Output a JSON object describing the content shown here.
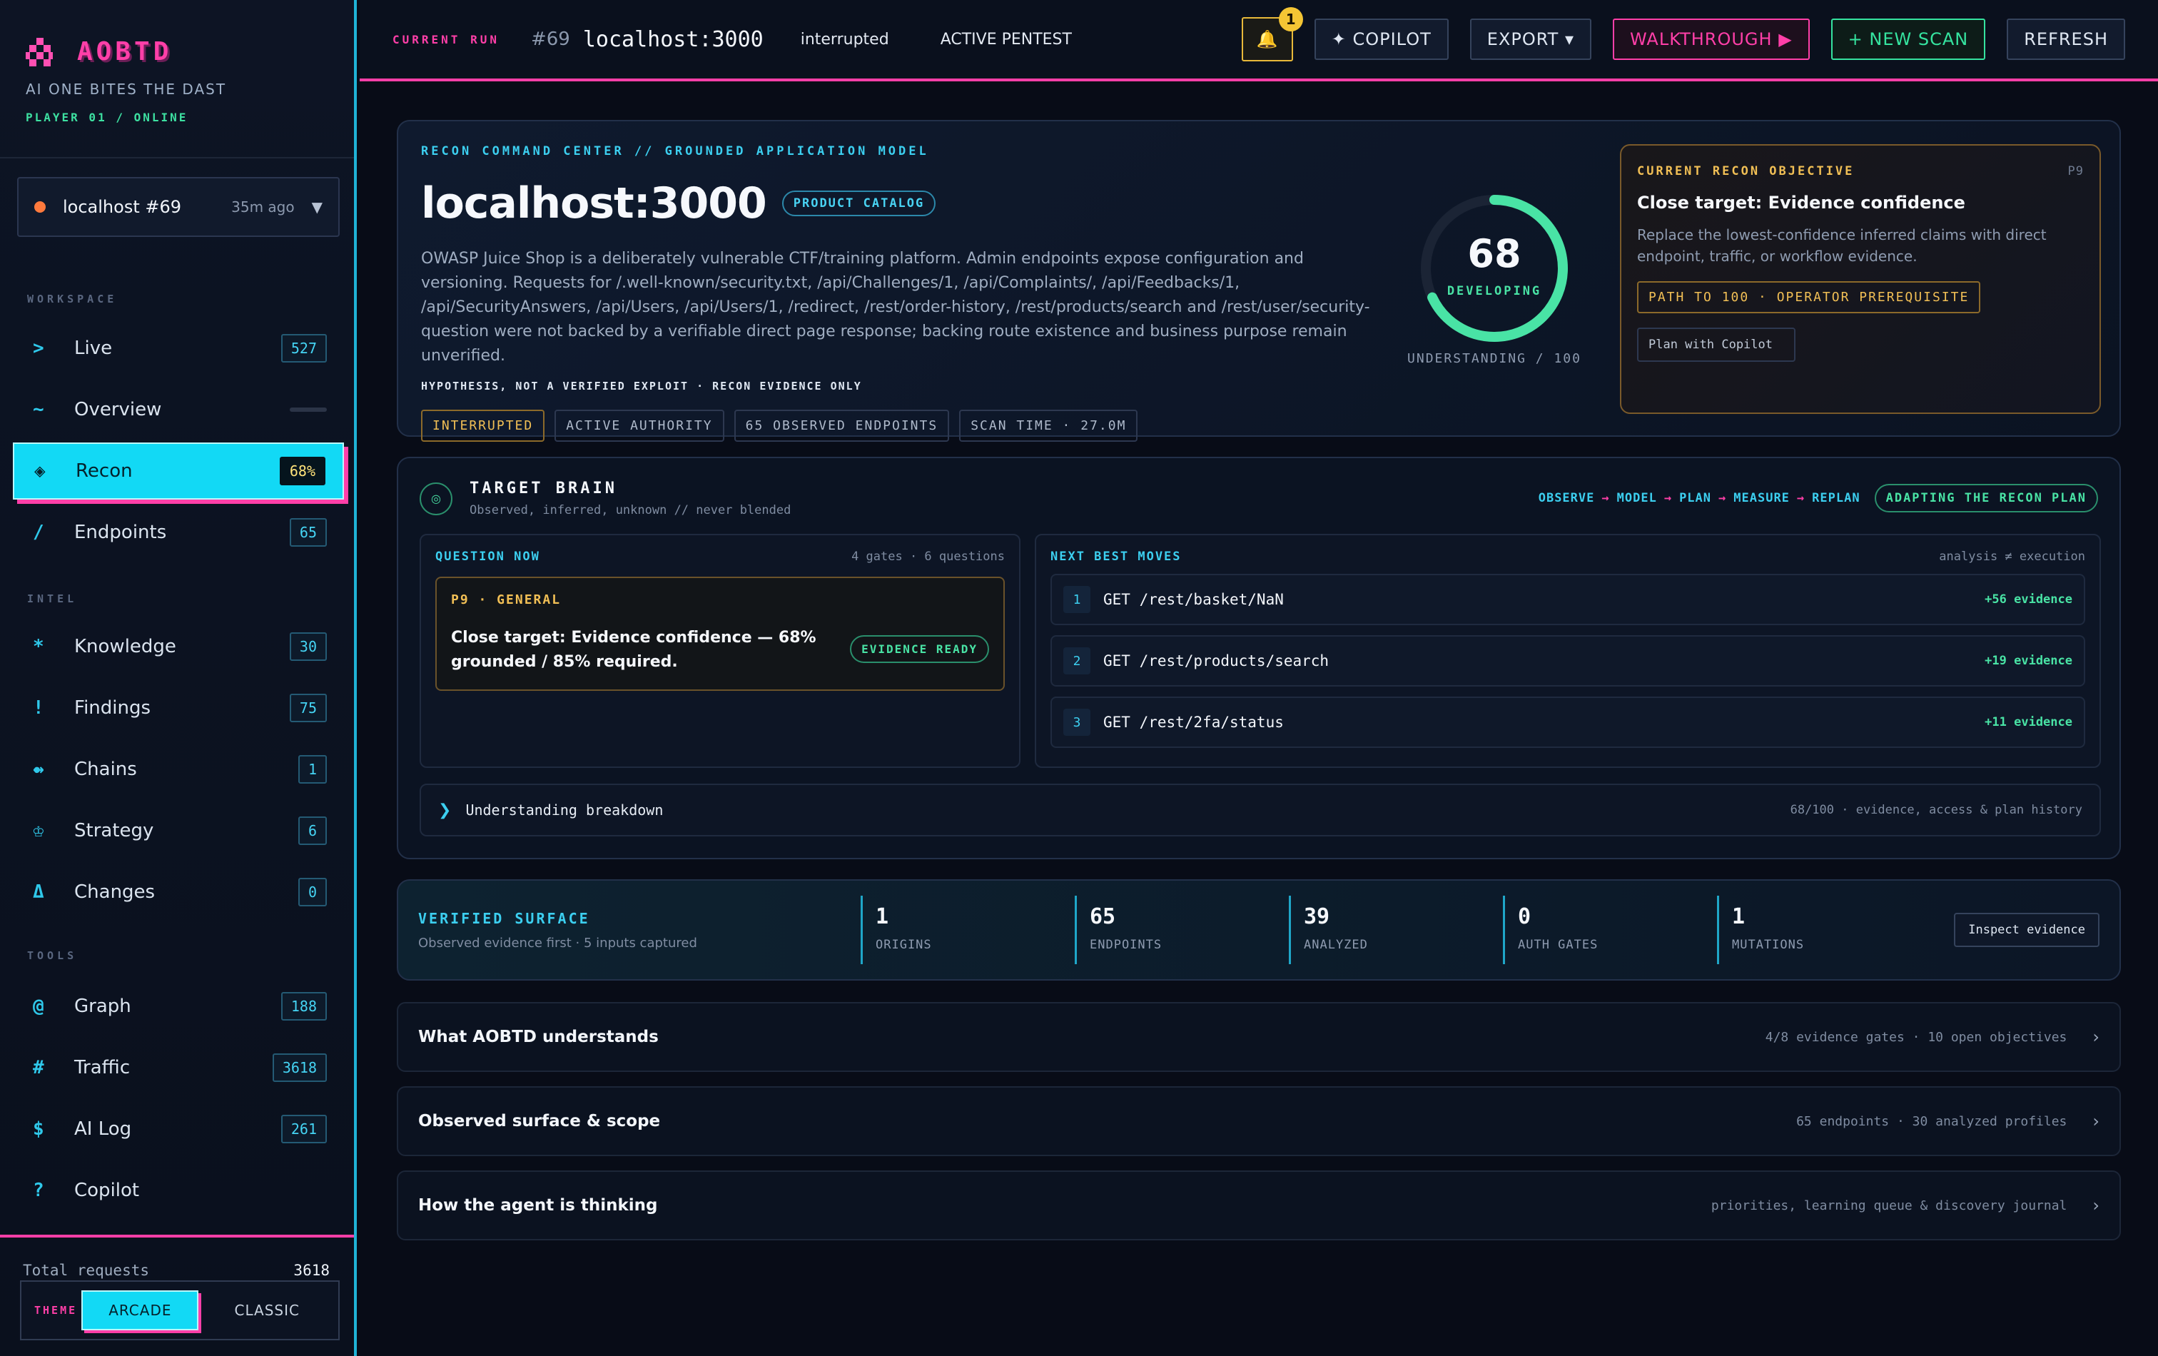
{
  "app": {
    "name": "AOBTD",
    "tagline": "AI ONE BITES THE DAST",
    "status": "PLAYER 01 / ONLINE"
  },
  "target_select": {
    "name": "localhost #69",
    "ago": "35m ago"
  },
  "nav": {
    "workspace_label": "WORKSPACE",
    "intel_label": "INTEL",
    "tools_label": "TOOLS",
    "items": [
      {
        "icon": ">",
        "label": "Live",
        "badge": "527"
      },
      {
        "icon": "~",
        "label": "Overview",
        "badge": ""
      },
      {
        "icon": "◈",
        "label": "Recon",
        "badge": "68%"
      },
      {
        "icon": "/",
        "label": "Endpoints",
        "badge": "65"
      },
      {
        "icon": "*",
        "label": "Knowledge",
        "badge": "30"
      },
      {
        "icon": "!",
        "label": "Findings",
        "badge": "75"
      },
      {
        "icon": "⇴",
        "label": "Chains",
        "badge": "1"
      },
      {
        "icon": "♔",
        "label": "Strategy",
        "badge": "6"
      },
      {
        "icon": "Δ",
        "label": "Changes",
        "badge": "0"
      },
      {
        "icon": "@",
        "label": "Graph",
        "badge": "188"
      },
      {
        "icon": "#",
        "label": "Traffic",
        "badge": "3618"
      },
      {
        "icon": "$",
        "label": "AI Log",
        "badge": "261"
      },
      {
        "icon": "?",
        "label": "Copilot",
        "badge": ""
      }
    ]
  },
  "footer": {
    "total_label": "Total requests",
    "total_value": "3618",
    "theme_label": "THEME",
    "theme_on": "ARCADE",
    "theme_off": "CLASSIC"
  },
  "topbar": {
    "run_label": "CURRENT RUN",
    "run_num": "#69",
    "host": "localhost:3000",
    "status": "interrupted",
    "mode": "ACTIVE PENTEST",
    "bell_icon": "🔔",
    "bell_count": "1",
    "copilot": "✦ COPILOT",
    "export": "EXPORT ▾",
    "walkthrough": "WALKTHROUGH ▶",
    "new_scan": "+ NEW SCAN",
    "refresh": "REFRESH"
  },
  "hero": {
    "eyebrow": "RECON COMMAND CENTER // GROUNDED APPLICATION MODEL",
    "title": "localhost:3000",
    "pill": "PRODUCT CATALOG",
    "description": "OWASP Juice Shop is a deliberately vulnerable CTF/training platform. Admin endpoints expose configuration and versioning. Requests for /.well-known/security.txt, /api/Challenges/1, /api/Complaints/, /api/Feedbacks/1, /api/SecurityAnswers, /api/Users, /api/Users/1, /redirect, /rest/order-history, /rest/products/search and /rest/user/security-question were not backed by a verifiable direct page response; backing route existence and business purpose remain unverified.",
    "note": "HYPOTHESIS, NOT A VERIFIED EXPLOIT · RECON EVIDENCE ONLY",
    "chips": [
      "INTERRUPTED",
      "ACTIVE AUTHORITY",
      "65 OBSERVED ENDPOINTS",
      "SCAN TIME · 27.0M"
    ],
    "score": 68,
    "score_label": "DEVELOPING",
    "score_sub": "UNDERSTANDING / 100",
    "accent": "#49e3a5",
    "objective": {
      "label": "CURRENT RECON OBJECTIVE",
      "priority": "P9",
      "title": "Close target: Evidence confidence",
      "desc": "Replace the lowest-confidence inferred claims with direct endpoint, traffic, or workflow evidence.",
      "path": "PATH TO 100 · OPERATOR PREREQUISITE",
      "plan": "Plan with Copilot"
    }
  },
  "brain": {
    "title": "TARGET BRAIN",
    "subtitle": "Observed, inferred, unknown // never blended",
    "loop": [
      "OBSERVE",
      "MODEL",
      "PLAN",
      "MEASURE",
      "REPLAN"
    ],
    "loop_arrow": "→",
    "adapt": "ADAPTING THE RECON PLAN",
    "question": {
      "label": "QUESTION NOW",
      "meta": "4 gates · 6 questions",
      "tag": "P9 · GENERAL",
      "text": "Close target: Evidence confidence — 68% grounded / 85% required.",
      "ready": "EVIDENCE READY"
    },
    "moves": {
      "label": "NEXT BEST MOVES",
      "meta": "analysis ≠ execution",
      "items": [
        {
          "n": "1",
          "path": "GET /rest/basket/NaN",
          "evidence": "+56 evidence"
        },
        {
          "n": "2",
          "path": "GET /rest/products/search",
          "evidence": "+19 evidence"
        },
        {
          "n": "3",
          "path": "GET /rest/2fa/status",
          "evidence": "+11 evidence"
        }
      ]
    },
    "breakdown": {
      "label": "Understanding breakdown",
      "meta": "68/100 · evidence, access & plan history"
    }
  },
  "surface": {
    "title": "VERIFIED SURFACE",
    "subtitle": "Observed evidence first · 5 inputs captured",
    "stats": [
      {
        "value": "1",
        "label": "ORIGINS"
      },
      {
        "value": "65",
        "label": "ENDPOINTS"
      },
      {
        "value": "39",
        "label": "ANALYZED"
      },
      {
        "value": "0",
        "label": "AUTH GATES"
      },
      {
        "value": "1",
        "label": "MUTATIONS"
      }
    ],
    "inspect": "Inspect evidence"
  },
  "accordions": [
    {
      "title": "What AOBTD understands",
      "meta": "4/8 evidence gates · 10 open objectives"
    },
    {
      "title": "Observed surface & scope",
      "meta": "65 endpoints · 30 analyzed profiles"
    },
    {
      "title": "How the agent is thinking",
      "meta": "priorities, learning queue & discovery journal"
    }
  ]
}
